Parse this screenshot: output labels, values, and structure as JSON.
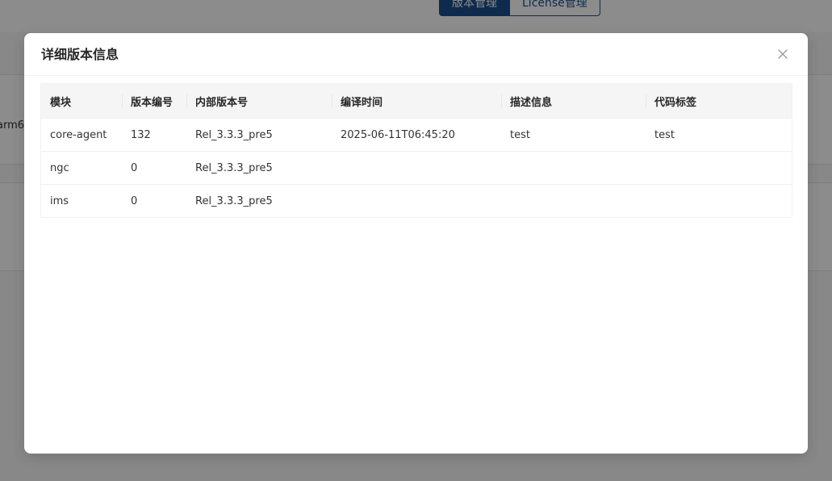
{
  "background": {
    "tabs": [
      {
        "label": "版本管理",
        "active": true
      },
      {
        "label": "License管理",
        "active": false
      }
    ],
    "fragment_text": "arm6"
  },
  "modal": {
    "title": "详细版本信息",
    "close_icon": "close-icon",
    "table": {
      "columns": [
        "模块",
        "版本编号",
        "内部版本号",
        "编译时间",
        "描述信息",
        "代码标签"
      ],
      "rows": [
        [
          "core-agent",
          "132",
          "Rel_3.3.3_pre5",
          "2025-06-11T06:45:20",
          "test",
          "test"
        ],
        [
          "ngc",
          "0",
          "Rel_3.3.3_pre5",
          "",
          "",
          ""
        ],
        [
          "ims",
          "0",
          "Rel_3.3.3_pre5",
          "",
          "",
          ""
        ]
      ]
    }
  },
  "colors": {
    "accent": "#1a4f8c",
    "mask": "rgba(0,0,0,0.45)",
    "header_bg": "#f5f5f5"
  }
}
